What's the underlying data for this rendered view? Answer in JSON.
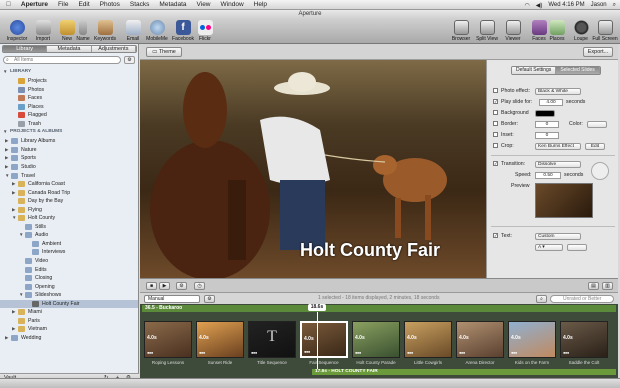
{
  "menubar": {
    "apple": "",
    "items": [
      "Aperture",
      "File",
      "Edit",
      "Photos",
      "Stacks",
      "Metadata",
      "View",
      "Window",
      "Help"
    ],
    "right": {
      "clock": "Wed 4:16 PM",
      "user": "Jason"
    }
  },
  "window": {
    "title": "Aperture"
  },
  "toolbar": {
    "left": [
      {
        "label": "Inspector",
        "icon": "info-icon"
      },
      {
        "label": "Import",
        "icon": "import-icon"
      },
      {
        "label": "New",
        "icon": "new-icon"
      },
      {
        "label": "Name",
        "icon": "name-icon"
      },
      {
        "label": "Keywords",
        "icon": "keywords-icon"
      },
      {
        "label": "Email",
        "icon": "email-icon"
      },
      {
        "label": "MobileMe",
        "icon": "mobileme-icon"
      },
      {
        "label": "Facebook",
        "icon": "facebook-icon"
      },
      {
        "label": "Flickr",
        "icon": "flickr-icon"
      }
    ],
    "right": [
      {
        "label": "Browser",
        "icon": "browser-icon"
      },
      {
        "label": "Split View",
        "icon": "split-view-icon"
      },
      {
        "label": "Viewer",
        "icon": "viewer-icon"
      },
      {
        "label": "Faces",
        "icon": "faces-icon"
      },
      {
        "label": "Places",
        "icon": "places-icon"
      },
      {
        "label": "Loupe",
        "icon": "loupe-icon"
      },
      {
        "label": "Full Screen",
        "icon": "full-screen-icon"
      }
    ]
  },
  "sidebar": {
    "tabs": [
      "Library",
      "Metadata",
      "Adjustments"
    ],
    "search_placeholder": "All Items",
    "tree": [
      {
        "label": "LIBRARY",
        "head": true,
        "indent": 0
      },
      {
        "label": "Projects",
        "indent": 2,
        "color": "#d9a43a"
      },
      {
        "label": "Photos",
        "indent": 2,
        "color": "#7a8fb2"
      },
      {
        "label": "Faces",
        "indent": 2,
        "color": "#c07a55"
      },
      {
        "label": "Places",
        "indent": 2,
        "color": "#6aa0c8"
      },
      {
        "label": "Flagged",
        "indent": 2,
        "color": "#d84a3a"
      },
      {
        "label": "Trash",
        "indent": 2,
        "color": "#9aa0a8"
      },
      {
        "label": "PROJECTS & ALBUMS",
        "head": true,
        "indent": 0
      },
      {
        "label": "Library Albums",
        "indent": 1,
        "color": "#8da6c8",
        "tri": "▶"
      },
      {
        "label": "Nature",
        "indent": 1,
        "color": "#8da6c8",
        "tri": "▶"
      },
      {
        "label": "Sports",
        "indent": 1,
        "color": "#8da6c8",
        "tri": "▶"
      },
      {
        "label": "Studio",
        "indent": 1,
        "color": "#8da6c8",
        "tri": "▶"
      },
      {
        "label": "Travel",
        "indent": 1,
        "color": "#8da6c8",
        "tri": "▼"
      },
      {
        "label": "California Coast",
        "indent": 2,
        "color": "#d9b35a",
        "tri": "▶"
      },
      {
        "label": "Canada Road Trip",
        "indent": 2,
        "color": "#d9b35a",
        "tri": "▶"
      },
      {
        "label": "Day by the Bay",
        "indent": 2,
        "color": "#d9b35a"
      },
      {
        "label": "Flying",
        "indent": 2,
        "color": "#d9b35a",
        "tri": "▶"
      },
      {
        "label": "Holt County",
        "indent": 2,
        "color": "#d9b35a",
        "tri": "▼"
      },
      {
        "label": "Stills",
        "indent": 3,
        "color": "#8da6c8"
      },
      {
        "label": "Audio",
        "indent": 3,
        "color": "#8da6c8",
        "tri": "▼"
      },
      {
        "label": "Ambient",
        "indent": 4,
        "color": "#8da6c8"
      },
      {
        "label": "Interviews",
        "indent": 4,
        "color": "#8da6c8"
      },
      {
        "label": "Video",
        "indent": 3,
        "color": "#8da6c8"
      },
      {
        "label": "Edits",
        "indent": 3,
        "color": "#8da6c8"
      },
      {
        "label": "Closing",
        "indent": 3,
        "color": "#8da6c8"
      },
      {
        "label": "Opening",
        "indent": 3,
        "color": "#8da6c8"
      },
      {
        "label": "Slideshows",
        "indent": 3,
        "color": "#8da6c8",
        "tri": "▼"
      },
      {
        "label": "Holt County Fair",
        "indent": 4,
        "color": "#666",
        "sel": true
      },
      {
        "label": "Miami",
        "indent": 2,
        "color": "#d9b35a",
        "tri": "▶"
      },
      {
        "label": "Paris",
        "indent": 2,
        "color": "#d9b35a"
      },
      {
        "label": "Vietnam",
        "indent": 2,
        "color": "#d9b35a",
        "tri": "▶"
      },
      {
        "label": "Wedding",
        "indent": 1,
        "color": "#8da6c8",
        "tri": "▶"
      }
    ],
    "bottom_label": "Vault"
  },
  "viewer": {
    "theme_label": "Theme",
    "export_label": "Export...",
    "caption": "Holt County Fair"
  },
  "inspector": {
    "tabs": [
      "Default Settings",
      "Selected Slides"
    ],
    "photo_effect_label": "Photo effect:",
    "photo_effect_value": "Black & White",
    "play_slide_label": "Play slide for:",
    "play_slide_value": "4.00",
    "play_slide_unit": "seconds",
    "background_label": "Background",
    "border_label": "Border:",
    "border_value": "0",
    "color_label": "Color:",
    "inset_label": "Inset:",
    "inset_value": "0",
    "crop_label": "Crop:",
    "crop_value": "Ken Burns Effect",
    "edit_label": "Edit",
    "transition_label": "Transition:",
    "transition_value": "Dissolve",
    "speed_label": "Speed:",
    "speed_value": "0.50",
    "speed_unit": "seconds",
    "preview_label": "Preview",
    "text_label": "Text:",
    "text_value": "Custom"
  },
  "browserbar": {
    "sort_value": "Manual",
    "status": "1 selected - 18 items displayed, 2 minutes, 18 seconds",
    "search_placeholder": "Unrated or Better"
  },
  "timeline": {
    "sequence_label": "36.5 - Buckaroo",
    "duration_badge": "18.6s",
    "audio_label": "17.6s - HOLT COUNTY FAIR",
    "clips": [
      {
        "label": "Roping Lessons",
        "dur": "4.0s",
        "color1": "#8a6a4a",
        "color2": "#4a3020"
      },
      {
        "label": "Sunset Ride",
        "dur": "4.0s",
        "color1": "#e0a050",
        "color2": "#6a4020"
      },
      {
        "label": "Title Sequence",
        "dur": "",
        "color1": "#222222",
        "color2": "#111111",
        "title": "T"
      },
      {
        "label": "Fair Sequence",
        "dur": "4.0s",
        "color1": "#7a5a3a",
        "color2": "#3a2818",
        "sel": true
      },
      {
        "label": "Holt County Parade",
        "dur": "4.0s",
        "color1": "#8aa060",
        "color2": "#3a5030"
      },
      {
        "label": "Little Cowgirls",
        "dur": "4.0s",
        "color1": "#c8a060",
        "color2": "#6a4a28"
      },
      {
        "label": "Arena Director",
        "dur": "4.0s",
        "color1": "#b09070",
        "color2": "#5a4030"
      },
      {
        "label": "Kids on the Farm",
        "dur": "4.0s",
        "color1": "#90b0d0",
        "color2": "#c08a60"
      },
      {
        "label": "Saddle the Colt",
        "dur": "4.0s",
        "color1": "#6a5a48",
        "color2": "#2a2018"
      }
    ]
  }
}
